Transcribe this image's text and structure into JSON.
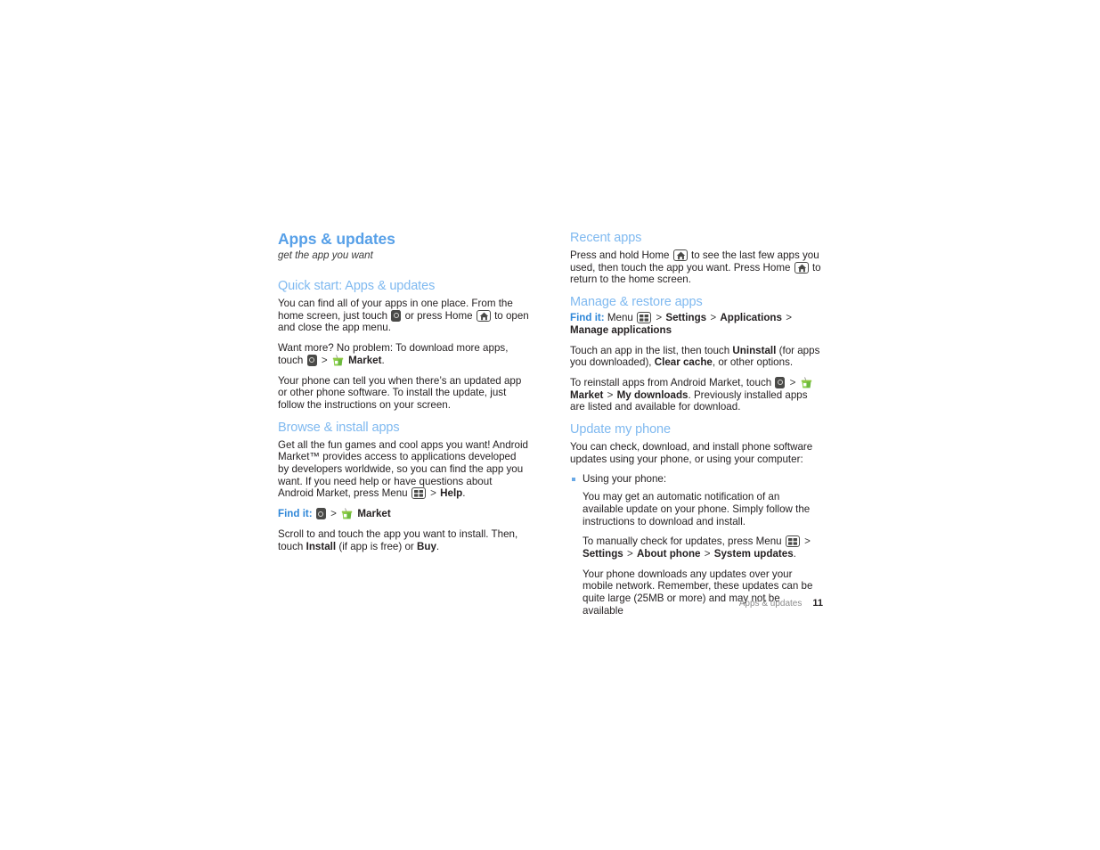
{
  "document": {
    "chapter_title": "Apps & updates",
    "chapter_subtitle": "get the app you want"
  },
  "left_column": {
    "sections": [
      {
        "heading": "Quick start: Apps & updates",
        "paragraphs": [
          "You can find all of your apps in one place. From the home screen, just touch",
          "or press Home",
          "to open and close the app menu."
        ]
      },
      {
        "p_want_more_1": "Want more? No problem: To download more apps, touch",
        "p_want_more_gt": ">",
        "p_want_more_market": "Market",
        "p_want_more_end": ".",
        "p_updated_app": "Your phone can tell you when there’s an updated app or other phone software. To install the update, just follow the instructions on your screen."
      },
      {
        "heading": "Browse & install apps",
        "p_browse_1": "Get all the fun games and cool apps you want! Android Market™ provides access to applications developed by developers worldwide, so you can find the app you want. If you need help or have questions about Android Market, press Menu",
        "p_browse_gt": ">",
        "p_browse_help": "Help",
        "p_browse_end": ".",
        "findit_label": "Find it:",
        "findit_gt": ">",
        "findit_market": "Market",
        "p_scroll_1": "Scroll to and touch the app you want to install. Then, touch",
        "p_scroll_install": "Install",
        "p_scroll_mid": "(if app is free) or",
        "p_scroll_buy": "Buy",
        "p_scroll_end": "."
      }
    ]
  },
  "right_column": {
    "recent_apps": {
      "heading": "Recent apps",
      "p_1": "Press and hold Home",
      "p_2": "to see the last few apps you used, then touch the app you want. Press Home",
      "p_3": "to return to the home screen."
    },
    "manage_restore": {
      "heading": "Manage & restore apps",
      "findit_label": "Find it:",
      "findit_menu": "Menu",
      "findit_gt1": ">",
      "findit_settings": "Settings",
      "findit_gt2": ">",
      "findit_applications": "Applications",
      "findit_gt3": ">",
      "findit_manage": "Manage applications",
      "p_touch_1": "Touch an app in the list, then touch",
      "p_touch_uninstall": "Uninstall",
      "p_touch_mid": "(for apps you downloaded),",
      "p_touch_clearcache": "Clear cache",
      "p_touch_end": ", or other options.",
      "p_reinstall_1": "To reinstall apps from Android Market, touch",
      "p_reinstall_gt1": ">",
      "p_reinstall_market": "Market",
      "p_reinstall_gt2": ">",
      "p_reinstall_mydownloads": "My downloads",
      "p_reinstall_end": ". Previously installed apps are listed and available for download."
    },
    "update_phone": {
      "heading": "Update my phone",
      "intro": "You can check, download, and install phone software updates using your phone, or using your computer:",
      "bullet_1": "Using your phone:",
      "sub_1": "You may get an automatic notification of an available update on your phone. Simply follow the instructions to download and install.",
      "sub_2_1": "To manually check for updates, press Menu",
      "sub_2_gt1": ">",
      "sub_2_settings": "Settings",
      "sub_2_gt2": ">",
      "sub_2_about": "About phone",
      "sub_2_gt3": ">",
      "sub_2_system": "System updates",
      "sub_2_end": ".",
      "sub_3": "Your phone downloads any updates over your mobile network. Remember, these updates can be quite large (25MB or more) and may not be available"
    }
  },
  "footer": {
    "chapter": "Apps & updates",
    "page_number": "11"
  },
  "colors": {
    "title_blue": "#57a0e8",
    "section_blue": "#7fb9f0",
    "findit_blue": "#2f87d8",
    "bullet_blue": "#6aa9e6",
    "market_green": "#72bf44",
    "body_text": "#231f20",
    "footer_gray": "#8c8c8c"
  },
  "icons": {
    "launcher": "app-drawer-icon",
    "home": "home-key-icon",
    "menu": "menu-key-icon",
    "market": "market-bag-icon"
  }
}
